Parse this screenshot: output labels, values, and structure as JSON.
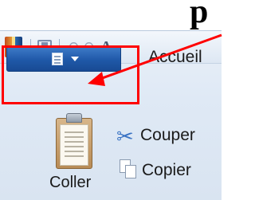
{
  "heading_fragment": "p",
  "quick_access": {
    "items": [
      "app-icon",
      "save-icon",
      "undo-icon",
      "redo-icon",
      "font-icon"
    ]
  },
  "ribbon": {
    "tab_home": "Accueil",
    "menu_caret": "▼"
  },
  "clipboard": {
    "paste_label": "Coller",
    "cut_label": "Couper",
    "copy_label": "Copier"
  },
  "annotation": {
    "highlight_color": "#ff0000"
  }
}
